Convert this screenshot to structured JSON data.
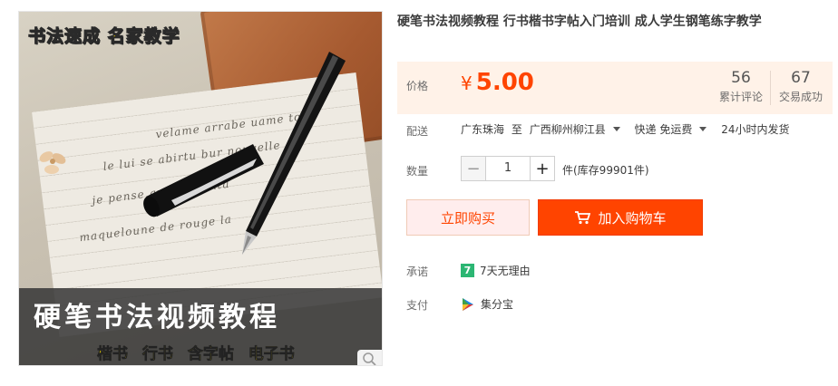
{
  "image": {
    "promo_top": "书法速成 名家教学",
    "promo_title": "硬笔书法视频教程",
    "promo_sub": "楷书 行书 含字帖 电子书",
    "zoom_icon": "magnifier-icon"
  },
  "product": {
    "title": "硬笔书法视频教程 行书楷书字帖入门培训 成人学生钢笔练字教学"
  },
  "price": {
    "label": "价格",
    "currency": "¥",
    "value": "5.00",
    "reviews_count": "56",
    "reviews_label": "累计评论",
    "sales_count": "67",
    "sales_label": "交易成功",
    "accent": "#ff4400"
  },
  "shipping": {
    "label": "配送",
    "from": "广东珠海",
    "to_word": "至",
    "to": "广西柳州柳江县",
    "method": "快递 免运费",
    "dispatch": "24小时内发货"
  },
  "quantity": {
    "label": "数量",
    "minus": "−",
    "value": "1",
    "plus": "+",
    "stock": "件(库存99901件)"
  },
  "actions": {
    "buy_now": "立即购买",
    "add_to_cart": "加入购物车"
  },
  "promise": {
    "label": "承诺",
    "badge": "7",
    "text": "7天无理由"
  },
  "payment": {
    "label": "支付",
    "method": "集分宝"
  }
}
